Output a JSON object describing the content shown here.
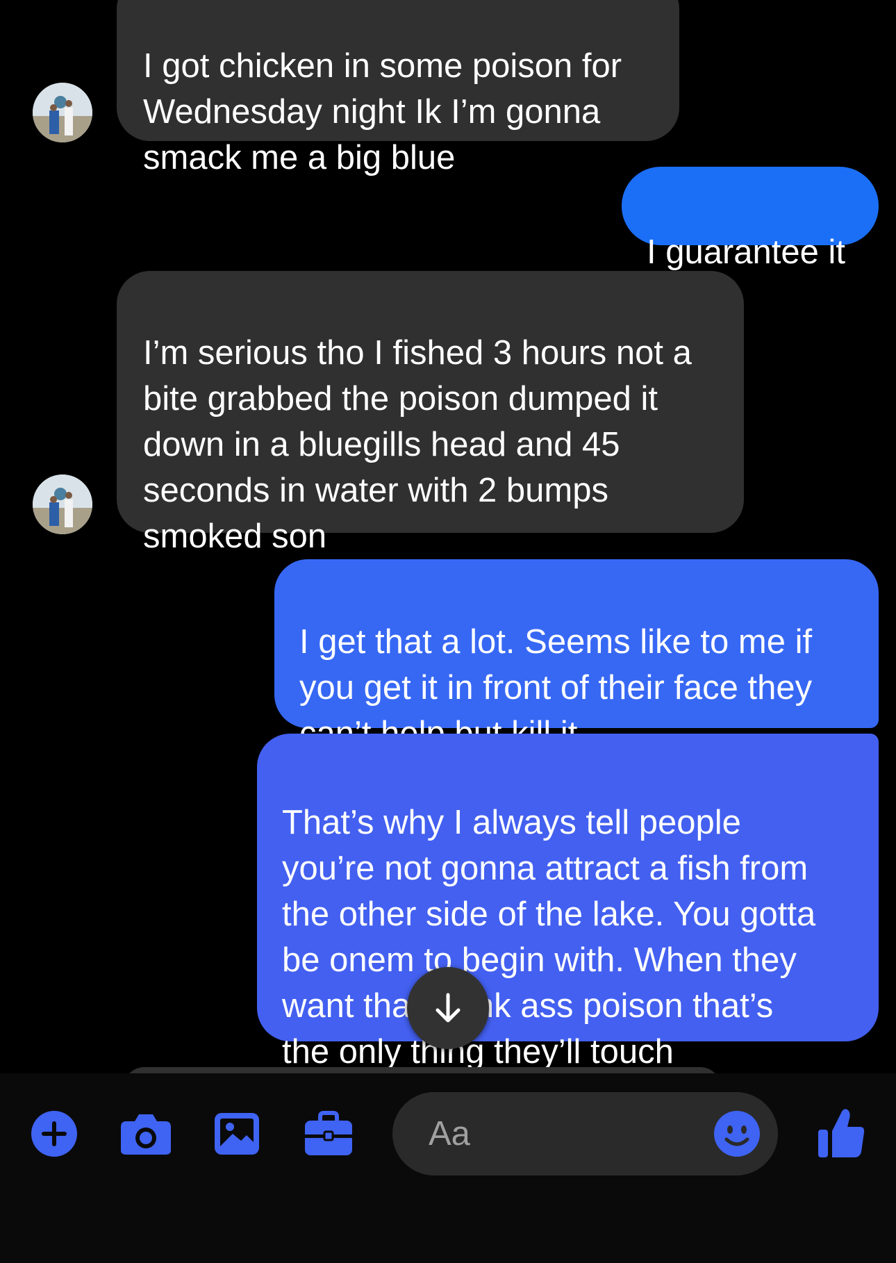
{
  "messages": [
    {
      "sender": "them",
      "text": "I got chicken in some poison for\nWednesday night Ik I’m gonna\nsmack me a big blue"
    },
    {
      "sender": "me",
      "text": "I guarantee it"
    },
    {
      "sender": "them",
      "text": "I’m serious tho I fished 3 hours not a\nbite grabbed the poison dumped it\ndown in a bluegills head and 45\nseconds in water with 2 bumps\nsmoked son"
    },
    {
      "sender": "me",
      "text": "I get that a lot. Seems like to me if\nyou get it in front of their face they\ncan’t help but kill it."
    },
    {
      "sender": "me",
      "text": "That’s why I always tell people\nyou’re not gonna attract a fish from\nthe other side of the lake. You gotta\nbe onem to begin with. When they\nwant that stank ass poison that’s\nthe only thing they’ll touch"
    }
  ],
  "composer": {
    "placeholder": "Aa",
    "icons": [
      "plus-icon",
      "camera-icon",
      "image-icon",
      "briefcase-icon",
      "emoji-icon",
      "thumbs-up-icon"
    ]
  },
  "colors": {
    "incoming_bubble": "#303030",
    "outgoing_top": "#1a6ff5",
    "outgoing_bottom": "#4560f0",
    "accent": "#3f63f2"
  }
}
